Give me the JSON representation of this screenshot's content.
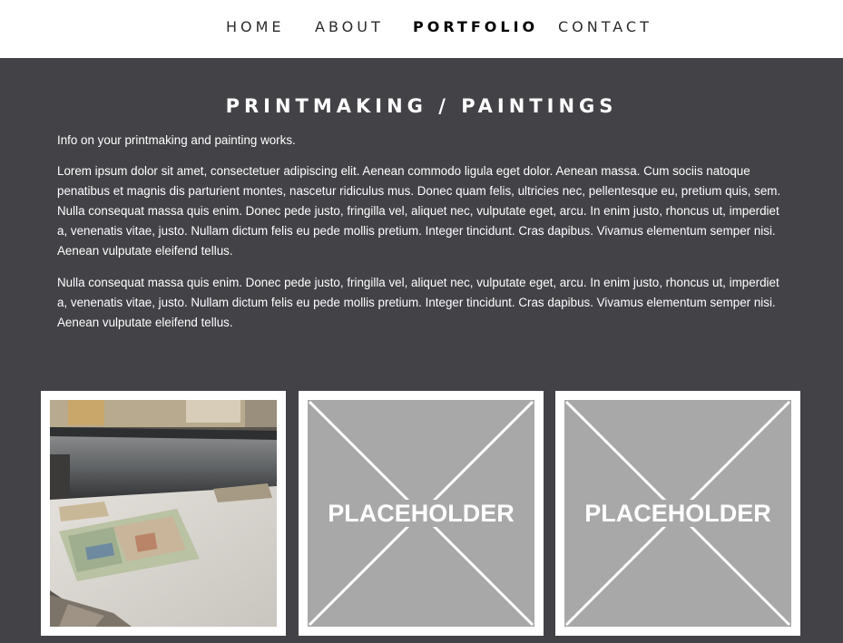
{
  "nav": {
    "items": [
      {
        "label": "HOME",
        "active": false
      },
      {
        "label": "ABOUT",
        "active": false
      },
      {
        "label": "PORTFOLIO",
        "active": true
      },
      {
        "label": "CONTACT",
        "active": false
      }
    ]
  },
  "section": {
    "title": "PRINTMAKING / PAINTINGS",
    "intro": "Info on your printmaking and painting works.",
    "paragraphs": [
      "Lorem ipsum dolor sit amet, consectetuer adipiscing elit. Aenean commodo ligula eget dolor. Aenean massa. Cum sociis natoque penatibus et magnis dis parturient montes, nascetur ridiculus mus. Donec quam felis, ultricies nec, pellentesque eu, pretium quis, sem. Nulla consequat massa quis enim. Donec pede justo, fringilla vel, aliquet nec, vulputate eget, arcu. In enim justo, rhoncus ut, imperdiet a, venenatis vitae, justo. Nullam dictum felis eu pede mollis pretium. Integer tincidunt. Cras dapibus. Vivamus elementum semper nisi. Aenean vulputate eleifend tellus.",
      "Nulla consequat massa quis enim. Donec pede justo, fringilla vel, aliquet nec, vulputate eget, arcu. In enim justo, rhoncus ut, imperdiet a, venenatis vitae, justo. Nullam dictum felis eu pede mollis pretium. Integer tincidunt. Cras dapibus. Vivamus elementum semper nisi. Aenean vulputate eleifend tellus."
    ]
  },
  "gallery": {
    "items": [
      {
        "type": "photo",
        "subject": "printing-press-photo"
      },
      {
        "type": "placeholder",
        "label": "PLACEHOLDER"
      },
      {
        "type": "placeholder",
        "label": "PLACEHOLDER"
      }
    ]
  },
  "colors": {
    "background": "#424247",
    "nav_background": "#ffffff",
    "placeholder_gray": "#a8a8a8",
    "text": "#ffffff"
  }
}
